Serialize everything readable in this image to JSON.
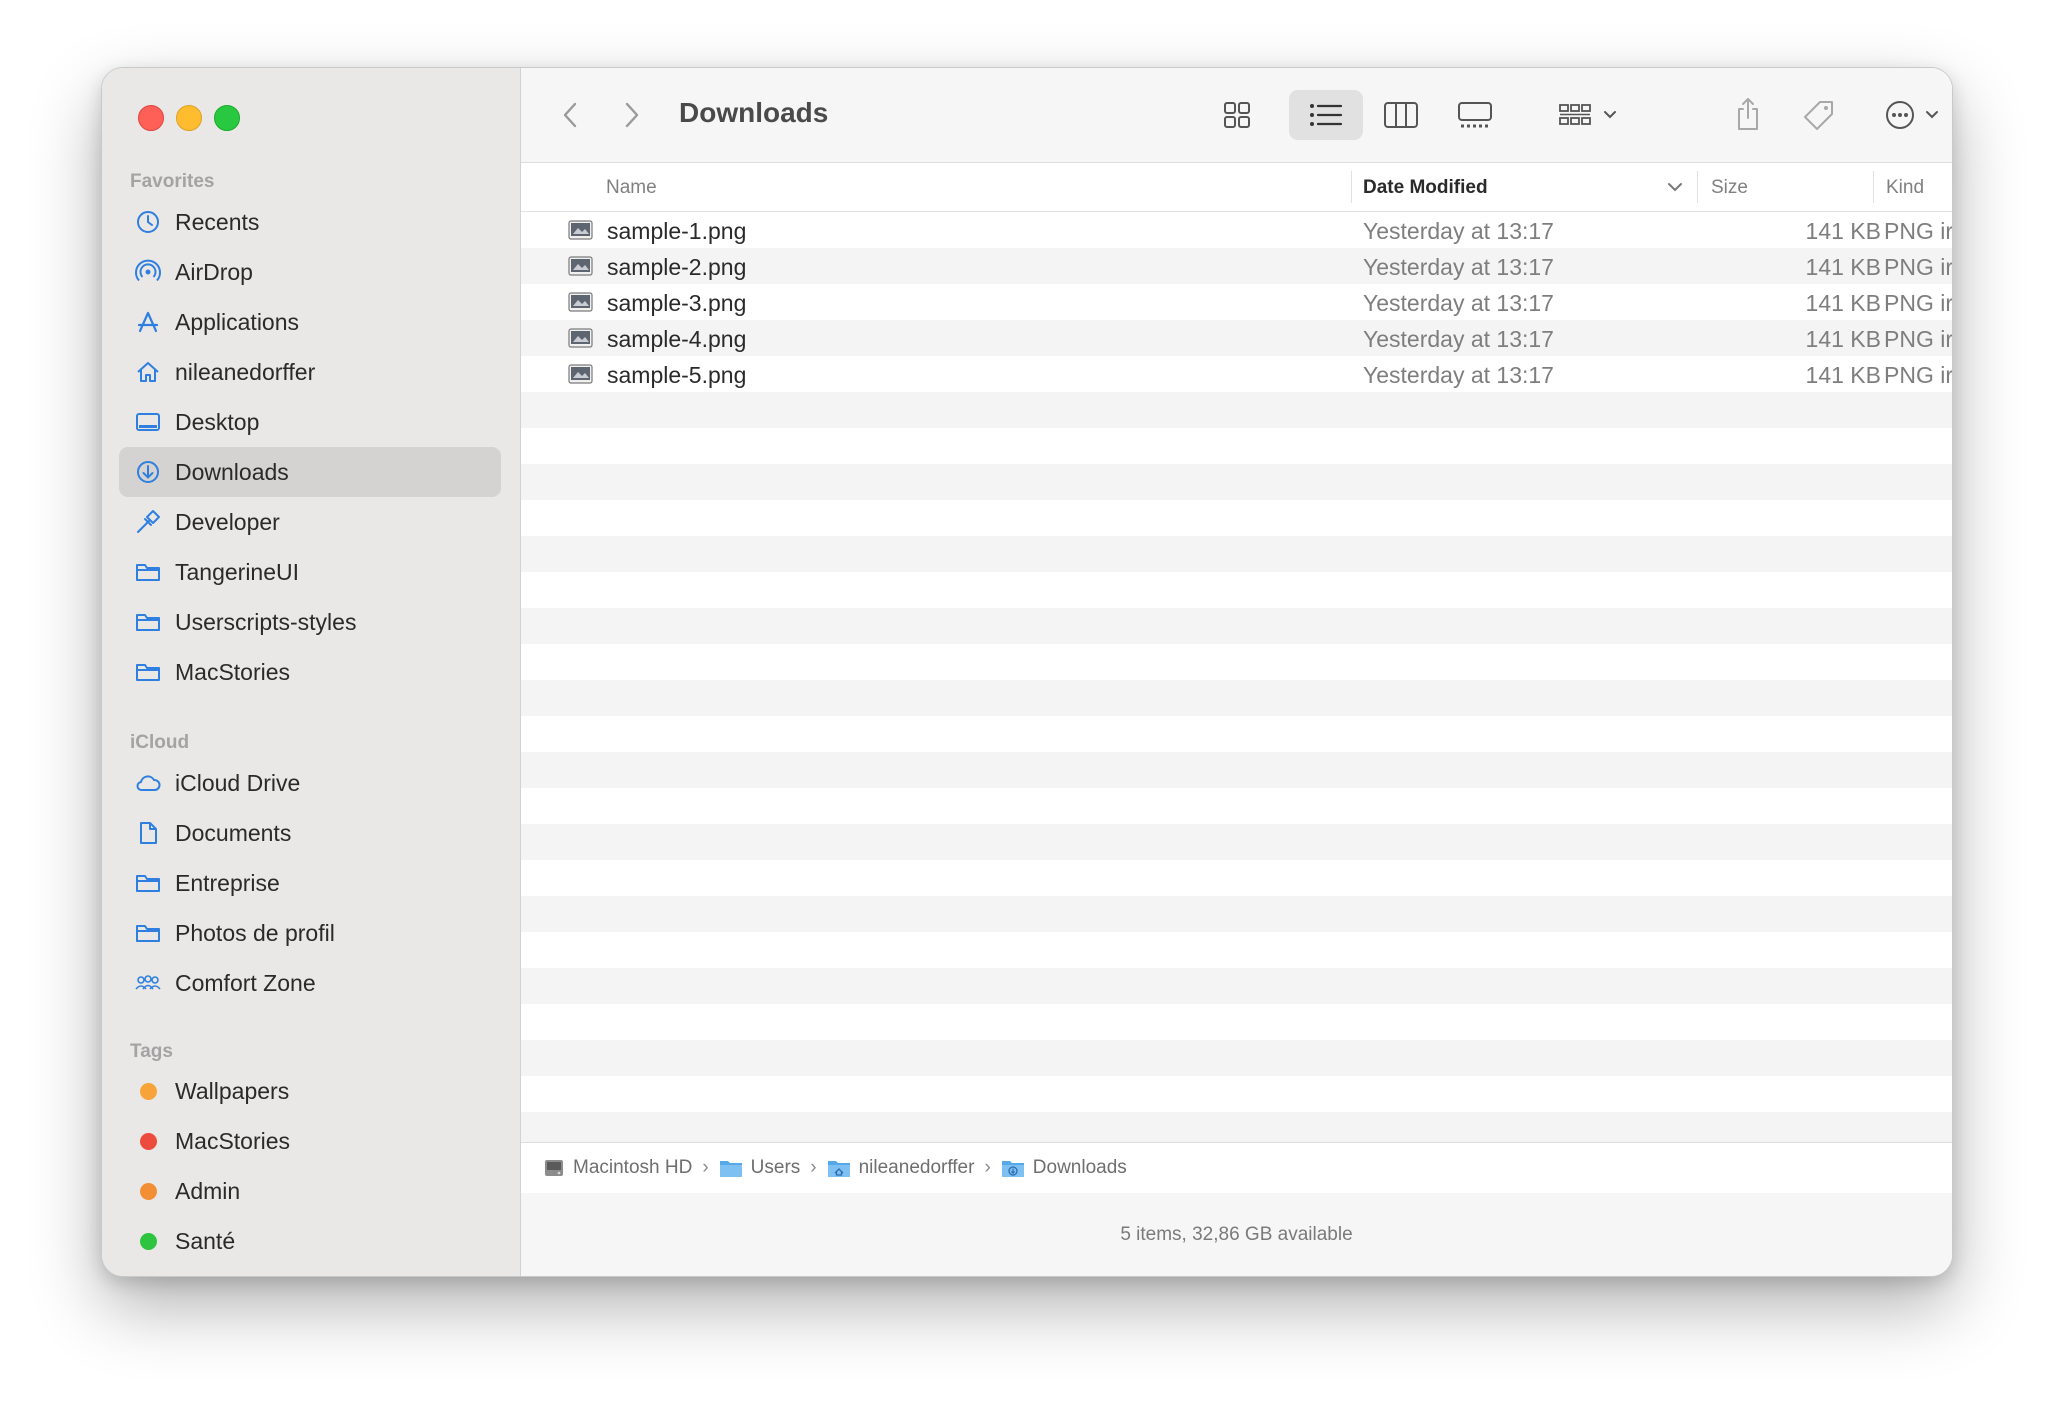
{
  "window": {
    "title": "Downloads"
  },
  "sidebar": {
    "favorites_header": "Favorites",
    "favorites": [
      {
        "label": "Recents",
        "icon": "clock-icon"
      },
      {
        "label": "AirDrop",
        "icon": "airdrop-icon"
      },
      {
        "label": "Applications",
        "icon": "applications-icon"
      },
      {
        "label": "nileanedorffer",
        "icon": "home-icon"
      },
      {
        "label": "Desktop",
        "icon": "desktop-icon"
      },
      {
        "label": "Downloads",
        "icon": "download-icon",
        "selected": true
      },
      {
        "label": "Developer",
        "icon": "hammer-icon"
      },
      {
        "label": "TangerineUI",
        "icon": "folder-icon"
      },
      {
        "label": "Userscripts-styles",
        "icon": "folder-icon"
      },
      {
        "label": "MacStories",
        "icon": "folder-icon"
      }
    ],
    "icloud_header": "iCloud",
    "icloud": [
      {
        "label": "iCloud Drive",
        "icon": "cloud-icon"
      },
      {
        "label": "Documents",
        "icon": "document-icon"
      },
      {
        "label": "Entreprise",
        "icon": "folder-icon"
      },
      {
        "label": "Photos de profil",
        "icon": "folder-icon"
      },
      {
        "label": "Comfort Zone",
        "icon": "shared-people-icon"
      }
    ],
    "tags_header": "Tags",
    "tags": [
      {
        "label": "Wallpapers",
        "color": "#f7a33a"
      },
      {
        "label": "MacStories",
        "color": "#ee4b3f"
      },
      {
        "label": "Admin",
        "color": "#f28f35"
      },
      {
        "label": "Santé",
        "color": "#2fc43f"
      }
    ]
  },
  "columns": {
    "name": "Name",
    "date": "Date Modified",
    "size": "Size",
    "kind": "Kind"
  },
  "files": [
    {
      "name": "sample-1.png",
      "date": "Yesterday at 13:17",
      "size": "141 KB",
      "kind": "PNG ir"
    },
    {
      "name": "sample-2.png",
      "date": "Yesterday at 13:17",
      "size": "141 KB",
      "kind": "PNG ir"
    },
    {
      "name": "sample-3.png",
      "date": "Yesterday at 13:17",
      "size": "141 KB",
      "kind": "PNG ir"
    },
    {
      "name": "sample-4.png",
      "date": "Yesterday at 13:17",
      "size": "141 KB",
      "kind": "PNG ir"
    },
    {
      "name": "sample-5.png",
      "date": "Yesterday at 13:17",
      "size": "141 KB",
      "kind": "PNG ir"
    }
  ],
  "pathbar": [
    "Macintosh HD",
    "Users",
    "nileanedorffer",
    "Downloads"
  ],
  "status": "5 items, 32,86 GB available",
  "colors": {
    "accent": "#2f7fe0",
    "sidebar_bg": "#e9e8e7",
    "selected_bg": "#d4d3d2"
  }
}
